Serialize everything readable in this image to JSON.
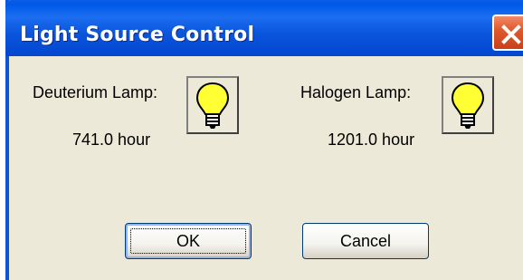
{
  "window": {
    "title": "Light Source Control"
  },
  "lamps": [
    {
      "label": "Deuterium Lamp:",
      "hours": "741.0 hour",
      "icon": "lightbulb-icon",
      "bulb_color": "#ffff33"
    },
    {
      "label": "Halogen Lamp:",
      "hours": "1201.0 hour",
      "icon": "lightbulb-icon",
      "bulb_color": "#ffff33"
    }
  ],
  "buttons": {
    "ok_label": "OK",
    "cancel_label": "Cancel"
  },
  "colors": {
    "title_bar": "#0a55dc",
    "close_button": "#e15a2c",
    "dialog_background": "#ece9d8"
  }
}
